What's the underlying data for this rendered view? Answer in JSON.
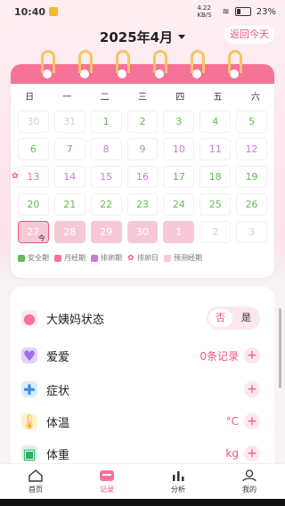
{
  "status_bar": {
    "time": "10:40",
    "net_speed": "4.22 KB/S",
    "battery": "23%"
  },
  "header": {
    "month_title": "2025年4月",
    "today_button": "返回今天"
  },
  "calendar": {
    "weekdays": [
      "日",
      "一",
      "二",
      "三",
      "四",
      "五",
      "六"
    ],
    "days": [
      {
        "d": "30",
        "t": "gray"
      },
      {
        "d": "31",
        "t": "gray"
      },
      {
        "d": "1",
        "t": "green"
      },
      {
        "d": "2",
        "t": "green"
      },
      {
        "d": "3",
        "t": "green"
      },
      {
        "d": "4",
        "t": "green"
      },
      {
        "d": "5",
        "t": "green"
      },
      {
        "d": "6",
        "t": "green"
      },
      {
        "d": "7",
        "t": "green"
      },
      {
        "d": "8",
        "t": "purple"
      },
      {
        "d": "9",
        "t": "purple"
      },
      {
        "d": "10",
        "t": "purple"
      },
      {
        "d": "11",
        "t": "purple"
      },
      {
        "d": "12",
        "t": "purple"
      },
      {
        "d": "13",
        "t": "purple",
        "flower": true
      },
      {
        "d": "14",
        "t": "purple"
      },
      {
        "d": "15",
        "t": "purple"
      },
      {
        "d": "16",
        "t": "purple"
      },
      {
        "d": "17",
        "t": "green"
      },
      {
        "d": "18",
        "t": "green"
      },
      {
        "d": "19",
        "t": "green"
      },
      {
        "d": "20",
        "t": "green"
      },
      {
        "d": "21",
        "t": "green"
      },
      {
        "d": "22",
        "t": "green"
      },
      {
        "d": "23",
        "t": "green"
      },
      {
        "d": "24",
        "t": "green"
      },
      {
        "d": "25",
        "t": "green"
      },
      {
        "d": "26",
        "t": "green"
      },
      {
        "d": "27",
        "t": "mens",
        "today": true
      },
      {
        "d": "28",
        "t": "mens"
      },
      {
        "d": "29",
        "t": "mens"
      },
      {
        "d": "30",
        "t": "mens"
      },
      {
        "d": "1",
        "t": "mens"
      },
      {
        "d": "2",
        "t": "gray"
      },
      {
        "d": "3",
        "t": "gray"
      }
    ],
    "today_label": "今",
    "legend": [
      {
        "label": "安全期",
        "color": "#67b85a"
      },
      {
        "label": "月经期",
        "color": "#f57397"
      },
      {
        "label": "排卵期",
        "color": "#cc7ad8"
      },
      {
        "label": "排卵日",
        "color": "#e9587c"
      },
      {
        "label": "预测经期",
        "color": "#f7c9d7"
      }
    ]
  },
  "records": {
    "period_status": {
      "label": "大姨妈状态",
      "off": "否",
      "on": "是"
    },
    "love": {
      "label": "爱爱",
      "value": "0条记录"
    },
    "symptom": {
      "label": "症状"
    },
    "temperature": {
      "label": "体温",
      "unit": "°C"
    },
    "weight": {
      "label": "体重",
      "unit": "kg"
    }
  },
  "tabs": [
    {
      "label": "首页"
    },
    {
      "label": "记录"
    },
    {
      "label": "分析"
    },
    {
      "label": "我的"
    }
  ]
}
